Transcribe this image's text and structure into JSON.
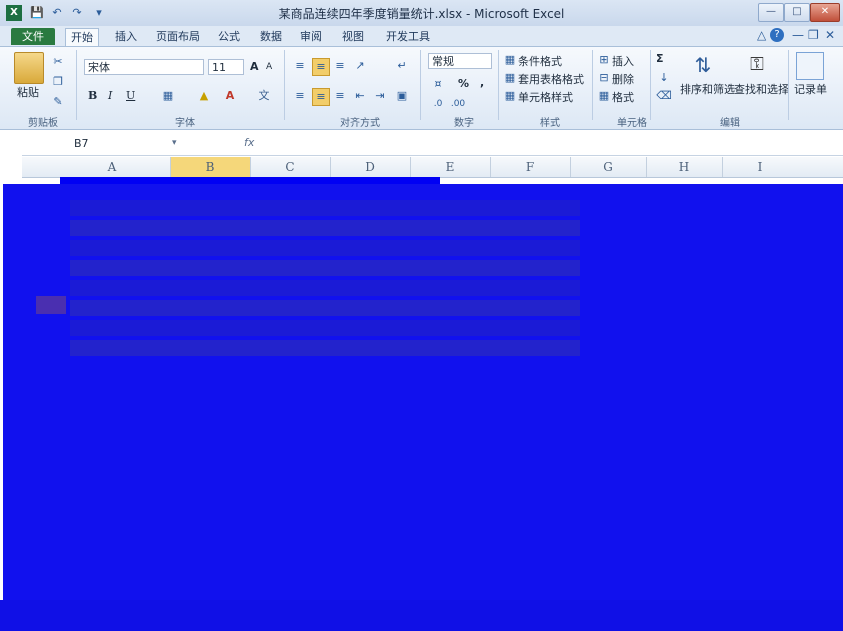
{
  "title_bar": {
    "document_title": "某商品连续四年季度销量统计.xlsx - Microsoft Excel",
    "app_icon": "X",
    "quick_access": [
      "save-icon",
      "undo-icon",
      "redo-icon",
      "customize-icon"
    ]
  },
  "tabs": {
    "file": "文件",
    "items": [
      "开始",
      "插入",
      "页面布局",
      "公式",
      "数据",
      "审阅",
      "视图",
      "开发工具"
    ]
  },
  "ribbon": {
    "clipboard": {
      "paste": "粘贴",
      "group": "剪贴板"
    },
    "font": {
      "name": "宋体",
      "size": "11",
      "bold": "B",
      "italic": "I",
      "underline": "U",
      "grow": "A",
      "shrink": "A",
      "group": "字体"
    },
    "alignment": {
      "group": "对齐方式"
    },
    "number": {
      "format": "常规",
      "percent": "%",
      "comma": ",",
      "group": "数字"
    },
    "styles": {
      "conditional": "条件格式",
      "table": "套用表格格式",
      "cell": "单元格样式",
      "group": "样式"
    },
    "cells": {
      "insert": "插入",
      "delete": "删除",
      "format": "格式",
      "group": "单元格"
    },
    "editing": {
      "sum": "Σ",
      "sort": "排序和筛选",
      "find": "查找和选择",
      "group": "编辑"
    },
    "record": {
      "label": "记录单"
    }
  },
  "formula_bar": {
    "name_box": "B7",
    "fx": "fx",
    "formula": ""
  },
  "columns": [
    "A",
    "B",
    "C",
    "D",
    "E",
    "F",
    "G",
    "H",
    "I"
  ]
}
